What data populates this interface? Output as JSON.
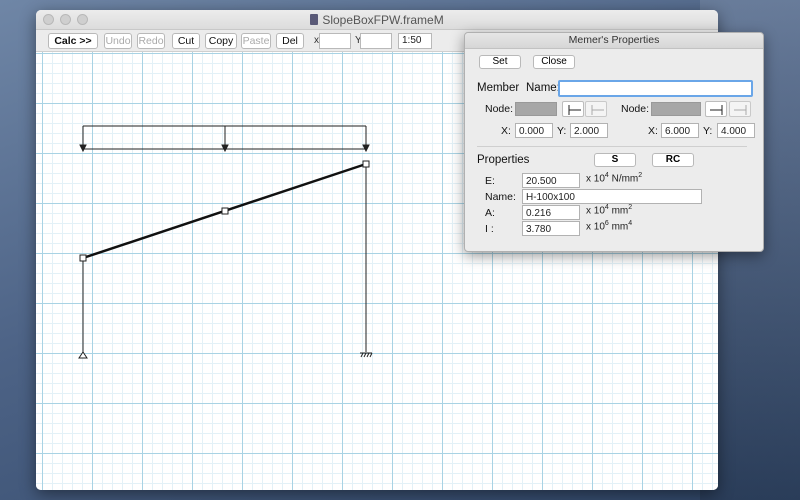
{
  "window": {
    "title": "SlopeBoxFPW.frameM"
  },
  "toolbar": {
    "calc": "Calc >>",
    "undo": "Undo",
    "redo": "Redo",
    "cut": "Cut",
    "copy": "Copy",
    "paste": "Paste",
    "del": "Del",
    "x_label": "x",
    "x_value": "",
    "y_label": "Y",
    "y_value": "",
    "scale": "1:50"
  },
  "panel": {
    "title": "Memer's Properties",
    "set": "Set",
    "close": "Close",
    "member_label": "Member",
    "name_label": "Name:",
    "name_value": "",
    "node_label_1": "Node:",
    "node_label_2": "Node:",
    "x_label_1": "X:",
    "x_value_1": "0.000",
    "y_label_1": "Y:",
    "y_value_1": "2.000",
    "x_label_2": "X:",
    "x_value_2": "6.000",
    "y_label_2": "Y:",
    "y_value_2": "4.000",
    "properties_label": "Properties",
    "s_button": "S",
    "rc_button": "RC",
    "e_label": "E:",
    "e_value": "20.500",
    "e_unit_base": "x 10",
    "e_unit_exp": "4",
    "e_unit_rest": " N/mm",
    "e_unit_exp2": "2",
    "section_name_label": "Name:",
    "section_name_value": "H-100x100",
    "a_label": "A:",
    "a_value": "0.216",
    "a_unit_base": "x 10",
    "a_unit_exp": "4",
    "a_unit_rest": " mm",
    "a_unit_exp2": "2",
    "i_label": "I :",
    "i_value": "3.780",
    "i_unit_base": "x 10",
    "i_unit_exp": "6",
    "i_unit_rest": " mm",
    "i_unit_exp2": "4"
  },
  "colors": {
    "grid_major": "#a9d3e4",
    "grid_minor": "#e3f1f7",
    "focus_ring": "#6aa6e8",
    "structure": "#222222"
  }
}
